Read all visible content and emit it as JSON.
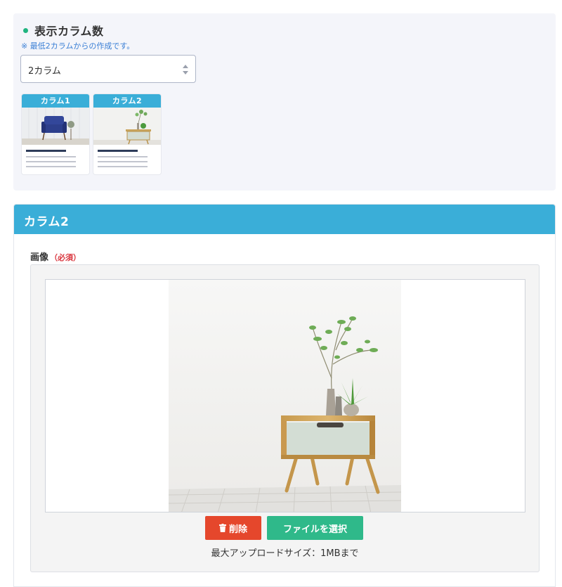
{
  "column_panel": {
    "title": "表示カラム数",
    "note": "※ 最低2カラムからの作成です。",
    "select_value": "2カラム",
    "thumbnails": [
      {
        "label": "カラム1",
        "image": "blue-armchair-photo"
      },
      {
        "label": "カラム2",
        "image": "side-table-plant-photo"
      }
    ]
  },
  "section": {
    "title": "カラム2",
    "image_label": "画像",
    "required_label": "（必須）",
    "delete_label": "削除",
    "select_file_label": "ファイルを選択",
    "size_note": "最大アップロードサイズ：1MBまで"
  },
  "colors": {
    "accent": "#3aaed8",
    "dot": "#1fb47f",
    "delete": "#e5472c",
    "select": "#2fb98a",
    "required": "#d9363e",
    "note": "#3a7fd5"
  },
  "icons": {
    "delete_button": "trash-icon",
    "select": "select-arrows-icon"
  }
}
